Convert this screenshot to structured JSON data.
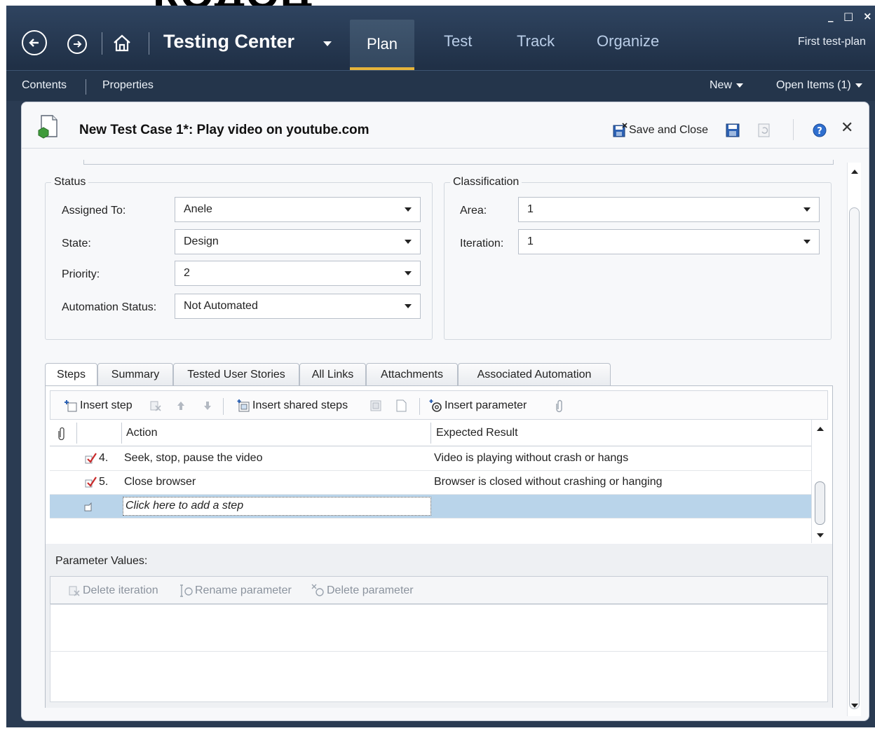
{
  "window": {
    "top_cut_text": "КОДОЦ",
    "app_title": "Testing Center",
    "test_plan": "First test-plan",
    "controls": {
      "minimize": "_",
      "maximize": "□",
      "close": "×"
    }
  },
  "nav": {
    "tabs": [
      {
        "label": "Plan",
        "active": true
      },
      {
        "label": "Test",
        "active": false
      },
      {
        "label": "Track",
        "active": false
      },
      {
        "label": "Organize",
        "active": false
      }
    ]
  },
  "subnav": {
    "contents": "Contents",
    "properties": "Properties",
    "new": "New",
    "open_items": "Open Items (1)"
  },
  "work_item": {
    "title": "New Test Case 1*: Play video on youtube.com",
    "save_and_close": "Save and Close",
    "close": "✕",
    "help": "?"
  },
  "status": {
    "title": "Status",
    "fields": [
      {
        "label": "Assigned To:",
        "value": "Anele"
      },
      {
        "label": "State:",
        "value": "Design"
      },
      {
        "label": "Priority:",
        "value": "2"
      },
      {
        "label": "Automation Status:",
        "value": "Not Automated"
      }
    ]
  },
  "classification": {
    "title": "Classification",
    "fields": [
      {
        "label": "Area:",
        "value": "1"
      },
      {
        "label": "Iteration:",
        "value": "1"
      }
    ]
  },
  "tabs": [
    {
      "label": "Steps",
      "active": true
    },
    {
      "label": "Summary",
      "active": false
    },
    {
      "label": "Tested User Stories",
      "active": false
    },
    {
      "label": "All Links",
      "active": false
    },
    {
      "label": "Attachments",
      "active": false
    },
    {
      "label": "Associated Automation",
      "active": false
    }
  ],
  "steps_toolbar": {
    "insert_step": "Insert step",
    "insert_shared_steps": "Insert shared steps",
    "insert_parameter": "Insert parameter"
  },
  "steps_grid": {
    "columns": {
      "action": "Action",
      "expected": "Expected Result"
    },
    "rows": [
      {
        "number": "4.",
        "action": "Seek, stop, pause the video",
        "expected": "Video is playing without crash or hangs"
      },
      {
        "number": "5.",
        "action": "Close browser",
        "expected": "Browser is closed without crashing or hanging"
      }
    ],
    "add_step_placeholder": "Click here to add a step"
  },
  "parameters": {
    "label": "Parameter Values:",
    "delete_iteration": "Delete iteration",
    "rename_parameter": "Rename parameter",
    "delete_parameter": "Delete parameter"
  },
  "colors": {
    "nav_bg": "#2a3b52",
    "active_tab_underline": "#e5b43a",
    "selected_row": "#b9d4ea"
  }
}
